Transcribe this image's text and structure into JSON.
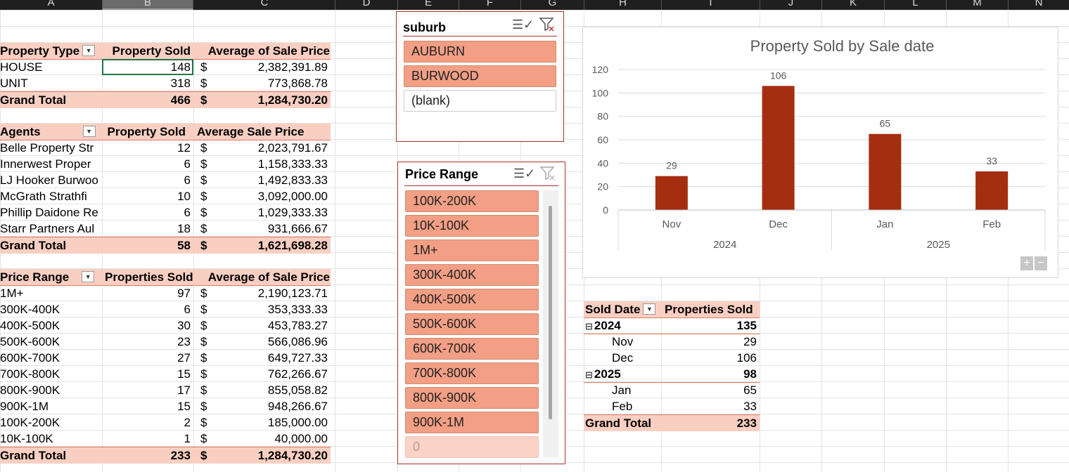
{
  "columns": [
    "A",
    "B",
    "C",
    "D",
    "E",
    "F",
    "G",
    "H",
    "I",
    "J",
    "K",
    "L",
    "M",
    "N"
  ],
  "pivot_property_type": {
    "headers": [
      "Property Type",
      "Property Sold",
      "Average of Sale Price"
    ],
    "rows": [
      {
        "label": "HOUSE",
        "count": "148",
        "cur": "$",
        "avg": "2,382,391.89"
      },
      {
        "label": "UNIT",
        "count": "318",
        "cur": "$",
        "avg": "773,868.78"
      }
    ],
    "total": {
      "label": "Grand Total",
      "count": "466",
      "cur": "$",
      "avg": "1,284,730.20"
    }
  },
  "pivot_agents": {
    "headers": [
      "Agents",
      "Property Sold",
      "Average  Sale Price"
    ],
    "rows": [
      {
        "label": "Belle Property Str",
        "count": "12",
        "cur": "$",
        "avg": "2,023,791.67"
      },
      {
        "label": "Innerwest Proper",
        "count": "6",
        "cur": "$",
        "avg": "1,158,333.33"
      },
      {
        "label": "LJ Hooker Burwoo",
        "count": "6",
        "cur": "$",
        "avg": "1,492,833.33"
      },
      {
        "label": "McGrath Strathfi",
        "count": "10",
        "cur": "$",
        "avg": "3,092,000.00"
      },
      {
        "label": "Phillip Daidone Re",
        "count": "6",
        "cur": "$",
        "avg": "1,029,333.33"
      },
      {
        "label": "Starr Partners Aul",
        "count": "18",
        "cur": "$",
        "avg": "931,666.67"
      }
    ],
    "total": {
      "label": "Grand Total",
      "count": "58",
      "cur": "$",
      "avg": "1,621,698.28"
    }
  },
  "pivot_price_range": {
    "headers": [
      "Price Range",
      "Properties Sold",
      "Average of Sale Price"
    ],
    "rows": [
      {
        "label": "1M+",
        "count": "97",
        "cur": "$",
        "avg": "2,190,123.71"
      },
      {
        "label": "300K-400K",
        "count": "6",
        "cur": "$",
        "avg": "353,333.33"
      },
      {
        "label": "400K-500K",
        "count": "30",
        "cur": "$",
        "avg": "453,783.27"
      },
      {
        "label": "500K-600K",
        "count": "23",
        "cur": "$",
        "avg": "566,086.96"
      },
      {
        "label": "600K-700K",
        "count": "27",
        "cur": "$",
        "avg": "649,727.33"
      },
      {
        "label": "700K-800K",
        "count": "15",
        "cur": "$",
        "avg": "762,266.67"
      },
      {
        "label": "800K-900K",
        "count": "17",
        "cur": "$",
        "avg": "855,058.82"
      },
      {
        "label": "900K-1M",
        "count": "15",
        "cur": "$",
        "avg": "948,266.67"
      },
      {
        "label": "100K-200K",
        "count": "2",
        "cur": "$",
        "avg": "185,000.00"
      },
      {
        "label": "10K-100K",
        "count": "1",
        "cur": "$",
        "avg": "40,000.00"
      }
    ],
    "total": {
      "label": "Grand Total",
      "count": "233",
      "cur": "$",
      "avg": "1,284,730.20"
    }
  },
  "slicer_suburb": {
    "title": "suburb",
    "items": [
      "AUBURN",
      "BURWOOD",
      "(blank)"
    ]
  },
  "slicer_price": {
    "title": "Price Range",
    "items": [
      "100K-200K",
      "10K-100K",
      "1M+",
      "300K-400K",
      "400K-500K",
      "500K-600K",
      "600K-700K",
      "700K-800K",
      "800K-900K",
      "900K-1M",
      "0"
    ]
  },
  "pivot_sold_date": {
    "headers": [
      "Sold Date",
      "Properties Sold"
    ],
    "rows": [
      {
        "label": "2024",
        "count": "135",
        "level": 0
      },
      {
        "label": "Nov",
        "count": "29",
        "level": 1
      },
      {
        "label": "Dec",
        "count": "106",
        "level": 1
      },
      {
        "label": "2025",
        "count": "98",
        "level": 0
      },
      {
        "label": "Jan",
        "count": "65",
        "level": 1
      },
      {
        "label": "Feb",
        "count": "33",
        "level": 1
      }
    ],
    "total": {
      "label": "Grand Total",
      "count": "233"
    }
  },
  "icons": {
    "multiselect": "multi-select-icon",
    "clear_filter": "clear-filter-icon",
    "dropdown": "dropdown-arrow-icon",
    "collapse": "collapse-icon"
  },
  "colors": {
    "accent": "#a33520",
    "header_fill": "#f9cfc2",
    "slicer_item": "#f29f85",
    "bar": "#a52e11"
  },
  "chart_data": {
    "type": "bar",
    "title": "Property Sold by Sale date",
    "categories": [
      "Nov",
      "Dec",
      "Jan",
      "Feb"
    ],
    "groups": [
      {
        "label": "2024",
        "categories": [
          "Nov",
          "Dec"
        ]
      },
      {
        "label": "2025",
        "categories": [
          "Jan",
          "Feb"
        ]
      }
    ],
    "values": [
      29,
      106,
      65,
      33
    ],
    "ylim": [
      0,
      120
    ],
    "yticks": [
      "0",
      "20",
      "40",
      "60",
      "80",
      "100",
      "120"
    ],
    "grid": true,
    "legend": "none"
  }
}
